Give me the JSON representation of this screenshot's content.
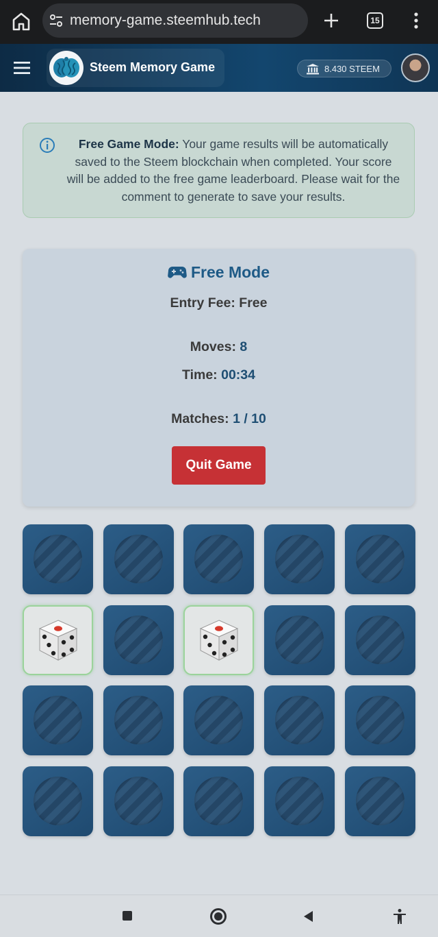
{
  "browser": {
    "url": "memory-game.steemhub.tech",
    "tab_count": "15",
    "icons": [
      "home-icon",
      "site-settings-icon",
      "plus-icon",
      "tabs-icon",
      "more-vert-icon"
    ]
  },
  "header": {
    "title": "Steem Memory Game",
    "balance": "8.430 STEEM",
    "icons": [
      "menu-icon",
      "brain-logo-icon",
      "bank-icon",
      "avatar"
    ]
  },
  "info": {
    "bold": "Free Game Mode:",
    "text": " Your game results will be automatically saved to the Steem blockchain when completed. Your score will be added to the free game leaderboard. Please wait for the comment to generate to save your results."
  },
  "game": {
    "mode_title": "Free Mode",
    "entry_label": "Entry Fee:",
    "entry_value": "Free",
    "moves_label": "Moves:",
    "moves_value": "8",
    "time_label": "Time:",
    "time_value": "00:34",
    "matches_label": "Matches:",
    "matches_value": "1 / 10",
    "quit_label": "Quit Game"
  },
  "board": {
    "rows": 4,
    "cols": 5,
    "flipped_cards": [
      5,
      7
    ],
    "flipped_symbol": "dice-icon"
  },
  "colors": {
    "header": "#13466e",
    "accent": "#1e5a86",
    "quit": "#c63135",
    "card_back": "#2c5d87",
    "match_border": "#9bd39b"
  }
}
